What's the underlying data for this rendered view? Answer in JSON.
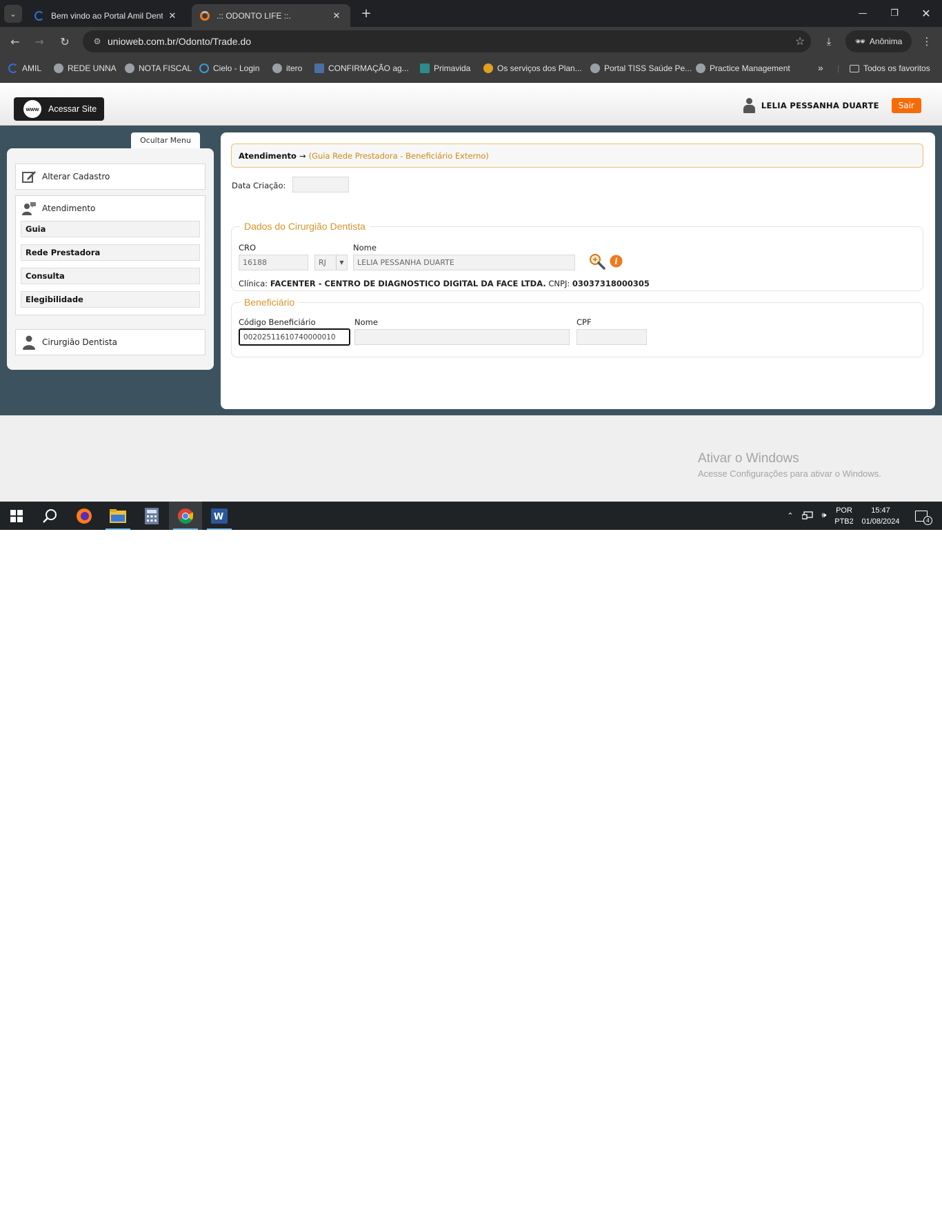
{
  "browser": {
    "tabs": [
      {
        "title": "Bem vindo ao Portal Amil Dental",
        "favicon_color": "#2f6fd6",
        "active": false
      },
      {
        "title": ".:: ODONTO LIFE ::.",
        "favicon_color": "#f07a1e",
        "active": true
      }
    ],
    "new_tab_icon": "plus-icon",
    "url": "unioweb.com.br/Odonto/Trade.do",
    "incognito_label": "Anônima",
    "bookmarks": [
      {
        "label": "AMIL",
        "icon_color": "#2f6fd6"
      },
      {
        "label": "REDE UNNA",
        "icon_color": "#9aa0a6"
      },
      {
        "label": "NOTA FISCAL",
        "icon_color": "#9aa0a6"
      },
      {
        "label": "Cielo - Login",
        "icon_color": "#3a9bd9"
      },
      {
        "label": "itero",
        "icon_color": "#9aa0a6"
      },
      {
        "label": "CONFIRMAÇÃO ag...",
        "icon_color": "#4a6fa5"
      },
      {
        "label": "Primavida",
        "icon_color": "#2e8b8b"
      },
      {
        "label": "Os serviços dos Plan...",
        "icon_color": "#e0a020"
      },
      {
        "label": "Portal TISS Saúde Pe...",
        "icon_color": "#9aa0a6"
      },
      {
        "label": "Practice Management",
        "icon_color": "#9aa0a6"
      }
    ],
    "all_bookmarks_label": "Todos os favoritos"
  },
  "header": {
    "site_button_label": "Acessar Site",
    "site_button_icon_text": "www",
    "user_name": "LELIA PESSANHA DUARTE",
    "logout_label": "Sair"
  },
  "sidebar": {
    "toggle_label": "Ocultar Menu",
    "alterar_cadastro": "Alterar Cadastro",
    "atendimento": "Atendimento",
    "subitems": [
      "Guia",
      "Rede Prestadora",
      "Consulta",
      "Elegibilidade"
    ],
    "cirurgiao": "Cirurgião Dentista"
  },
  "main": {
    "breadcrumb_main": "Atendimento",
    "breadcrumb_arrow": "→",
    "breadcrumb_sub": "(Guia Rede Prestadora - Beneficiário Externo)",
    "data_criacao_label": "Data Criação:",
    "data_criacao_value": "",
    "dentista": {
      "legend": "Dados do Cirurgião Dentista",
      "cro_label": "CRO",
      "cro_value": "16188",
      "uf_value": "RJ",
      "nome_label": "Nome",
      "nome_value": "LELIA PESSANHA DUARTE",
      "clinica_label": "Clínica:",
      "clinica_value": "FACENTER - CENTRO DE DIAGNOSTICO DIGITAL DA FACE LTDA.",
      "cnpj_label": "CNPJ:",
      "cnpj_value": "03037318000305"
    },
    "beneficiario": {
      "legend": "Beneficiário",
      "codigo_label": "Código Beneficiário",
      "codigo_value": "00202511610740000010",
      "nome_label": "Nome",
      "nome_value": "",
      "cpf_label": "CPF",
      "cpf_value": ""
    }
  },
  "watermark": {
    "title": "Ativar o Windows",
    "subtitle": "Acesse Configurações para ativar o Windows."
  },
  "taskbar": {
    "lang_top": "POR",
    "lang_bottom": "PTB2",
    "time": "15:47",
    "date": "01/08/2024",
    "notification_count": "4"
  }
}
